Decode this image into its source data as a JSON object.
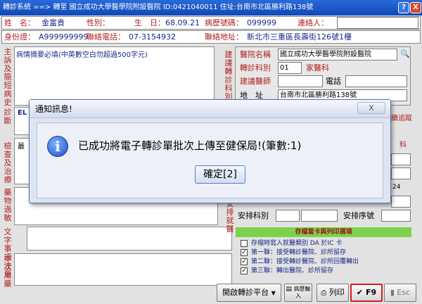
{
  "window": {
    "title": "轉診系統 ==> 轉至 國立成功大學醫學院附設醫院 ID:0421040011 住址:台南市北區勝利路138號",
    "help_label": "?",
    "close_label": "X"
  },
  "patient": {
    "name_label": "姓　名：",
    "name": "金富貴",
    "sex_label": "性別：",
    "sex": "",
    "birth_label": "生　日：",
    "birth": "68.09.21",
    "chart_label": "病歷號碼：",
    "chart": "099999",
    "contact_label": "連絡人：",
    "contact": "",
    "id_label": "身份證：",
    "id": "A999999999",
    "phone_label": "聯絡電話：",
    "phone": "07-3154932",
    "addr_label": "聯絡地址：",
    "addr": "新北市三重區長壽街126號1樓"
  },
  "left_labels": {
    "complaint": "主訴及簡短病史",
    "diagnosis": "診斷",
    "exam": "檢查及治療",
    "drugs": "藥物過敏",
    "notes": "文字事項注意",
    "notes2": "本次用藥"
  },
  "complaint_text": "病情摘要必填(中英數空白勿超過500字元)",
  "diagnosis_code": "EL",
  "exam_prefix": "最",
  "referral": {
    "section_label": "建議轉診科別",
    "hosp_label": "醫院名稱",
    "hosp_value": "國立成功大學醫學院附設醫院",
    "dept_label": "轉診科別",
    "dept_code": "01",
    "dept_name": "家醫科",
    "doctor_label": "建議醫師",
    "tel_label": "電話",
    "addr_label": "地　址",
    "addr_value": "台南市北區勝利路138號"
  },
  "right_side": {
    "track_label": "續追蹤",
    "dept_short": "科",
    "date_short": "24",
    "arrange_label": "安排就醫",
    "arrange_dept_label": "安排科別",
    "arrange_seq_label": "安排序號"
  },
  "options": {
    "header": "存檔寫卡與列印選項",
    "items": [
      {
        "label": "存檔時寫入就醫類別 DA 於IC 卡",
        "checked": false
      },
      {
        "label": "第一聯：接受轉診醫院、診所留存",
        "checked": true
      },
      {
        "label": "第二聯：接受轉診醫院、診所回覆轉出",
        "checked": true
      },
      {
        "label": "第三聯：轉出醫院、診所留存",
        "checked": true
      }
    ]
  },
  "toolbar": {
    "platform_label": "開啟轉診平台",
    "print_label": "列印",
    "medrec_label": "病歷輸入",
    "f9_label": "F9",
    "esc_label": "Esc"
  },
  "dialog": {
    "title": "通知訊息!",
    "close_label": "X",
    "message": "已成功將電子轉診單批次上傳至健保局!(筆數:1)",
    "ok_label": "確定[2]"
  },
  "colors": {
    "label_red": "#b02020",
    "value_blue": "#1a2a8a",
    "option_green": "#7ed24b"
  }
}
